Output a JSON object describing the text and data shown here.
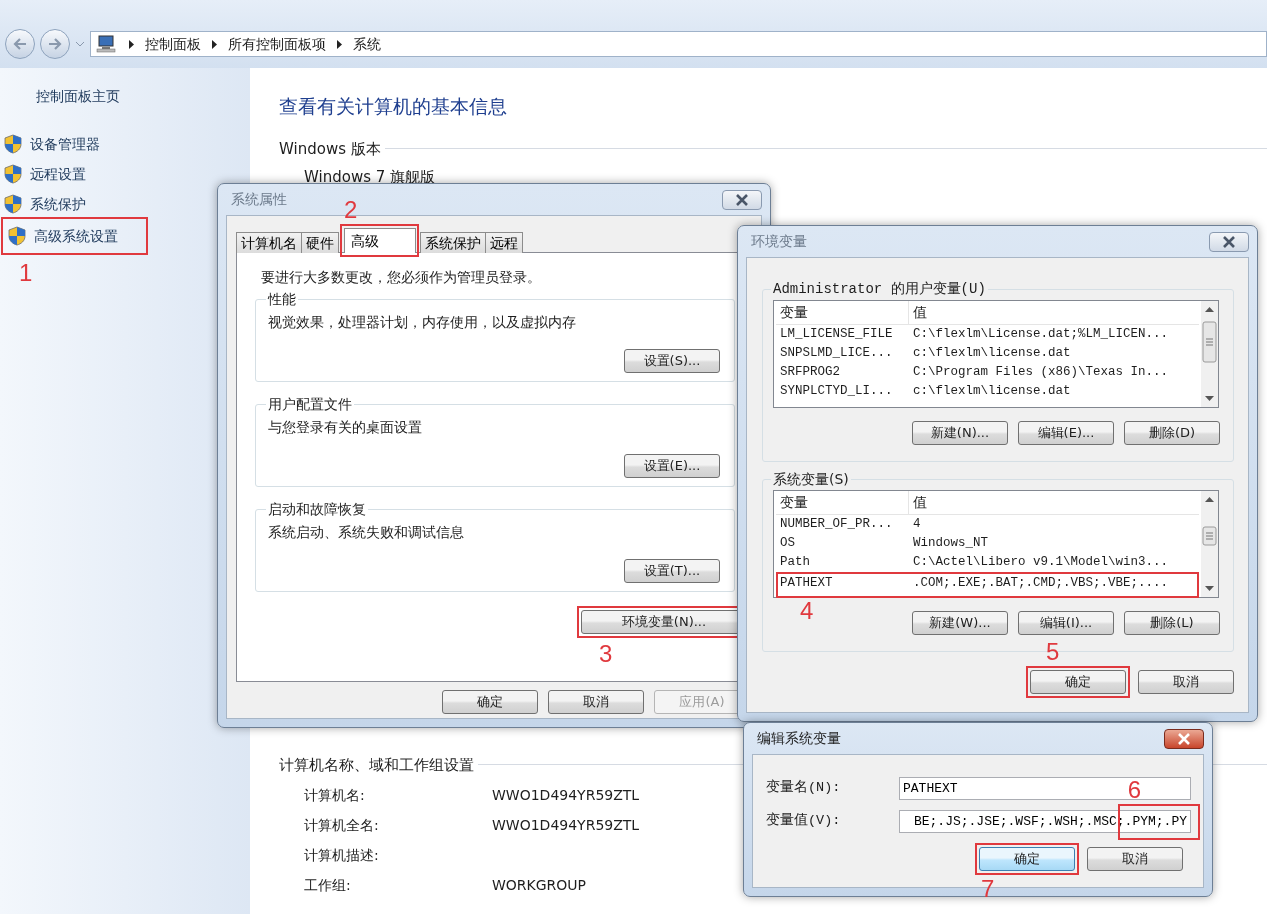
{
  "address_bar": {
    "breadcrumbs": [
      "控制面板",
      "所有控制面板项",
      "系统"
    ]
  },
  "sidebar": {
    "home": "控制面板主页",
    "links": [
      {
        "label": "设备管理器",
        "highlighted": false
      },
      {
        "label": "远程设置",
        "highlighted": false
      },
      {
        "label": "系统保护",
        "highlighted": false
      },
      {
        "label": "高级系统设置",
        "highlighted": true,
        "step": "1"
      }
    ]
  },
  "main": {
    "title": "查看有关计算机的基本信息",
    "edition_heading": "Windows 版本",
    "edition": "Windows 7 旗舰版",
    "computer_heading": "计算机名称、域和工作组设置",
    "computer_rows": [
      {
        "label": "计算机名:",
        "value": "WWO1D494YR59ZTL"
      },
      {
        "label": "计算机全名:",
        "value": "WWO1D494YR59ZTL"
      },
      {
        "label": "计算机描述:"
      },
      {
        "label": "工作组:",
        "value": "WORKGROUP"
      }
    ]
  },
  "system_properties": {
    "title": "系统属性",
    "active": false,
    "tabs": [
      {
        "label": "计算机名",
        "selected": false,
        "highlighted": false
      },
      {
        "label": "硬件",
        "selected": false,
        "highlighted": false
      },
      {
        "label": "高级",
        "selected": true,
        "highlighted": true,
        "step": "2"
      },
      {
        "label": "系统保护",
        "selected": false,
        "highlighted": false
      },
      {
        "label": "远程",
        "selected": false,
        "highlighted": false
      }
    ],
    "notice": "要进行大多数更改，您必须作为管理员登录。",
    "groups": [
      {
        "title": "性能",
        "description": "视觉效果，处理器计划，内存使用，以及虚拟内存",
        "button": "设置(S)..."
      },
      {
        "title": "用户配置文件",
        "description": "与您登录有关的桌面设置",
        "button": "设置(E)..."
      },
      {
        "title": "启动和故障恢复",
        "description": "系统启动、系统失败和调试信息",
        "button": "设置(T)..."
      }
    ],
    "env_button": {
      "label": "环境变量(N)...",
      "highlighted": true,
      "step": "3"
    },
    "buttons": [
      {
        "label": "确定",
        "disabled": false
      },
      {
        "label": "取消",
        "disabled": false
      },
      {
        "label": "应用(A)",
        "disabled": true
      }
    ]
  },
  "environment_variables": {
    "title": "环境变量",
    "active": false,
    "sections": [
      {
        "title": "Administrator 的用户变量(U)",
        "columns": [
          "变量",
          "值"
        ],
        "rows": [
          {
            "name": "LM_LICENSE_FILE",
            "value": "C:\\flexlm\\License.dat;%LM_LICEN...",
            "highlighted": false
          },
          {
            "name": "SNPSLMD_LICE...",
            "value": "c:\\flexlm\\license.dat",
            "highlighted": false
          },
          {
            "name": "SRFPROG2",
            "value": "C:\\Program Files (x86)\\Texas In...",
            "highlighted": false
          },
          {
            "name": "SYNPLCTYD_LI...",
            "value": "c:\\flexlm\\license.dat",
            "highlighted": false
          }
        ],
        "buttons": [
          "新建(N)...",
          "编辑(E)...",
          "删除(D)"
        ]
      },
      {
        "title": "系统变量(S)",
        "columns": [
          "变量",
          "值"
        ],
        "rows": [
          {
            "name": "NUMBER_OF_PR...",
            "value": "4",
            "highlighted": false
          },
          {
            "name": "OS",
            "value": "Windows_NT",
            "highlighted": false
          },
          {
            "name": "Path",
            "value": "C:\\Actel\\Libero v9.1\\Model\\win3...",
            "highlighted": false
          },
          {
            "name": "PATHEXT",
            "value": ".COM;.EXE;.BAT;.CMD;.VBS;.VBE;....",
            "highlighted": true,
            "step": "4"
          }
        ],
        "buttons": [
          "新建(W)...",
          "编辑(I)...",
          "删除(L)"
        ]
      }
    ],
    "buttons": [
      {
        "label": "确定",
        "highlighted": true,
        "step": "5"
      },
      {
        "label": "取消",
        "highlighted": false
      }
    ]
  },
  "edit_variable": {
    "title": "编辑系统变量",
    "active": true,
    "fields": [
      {
        "label": "变量名(N):",
        "value": "PATHEXT",
        "highlighted": false
      },
      {
        "label": "变量值(V):",
        "value": "BE;.JS;.JSE;.WSF;.WSH;.MSC;.PYM;.PY",
        "highlighted": true,
        "step": "6"
      }
    ],
    "buttons": [
      {
        "label": "确定",
        "default": true,
        "highlighted": true,
        "step": "7"
      },
      {
        "label": "取消",
        "default": false,
        "highlighted": false
      }
    ]
  }
}
